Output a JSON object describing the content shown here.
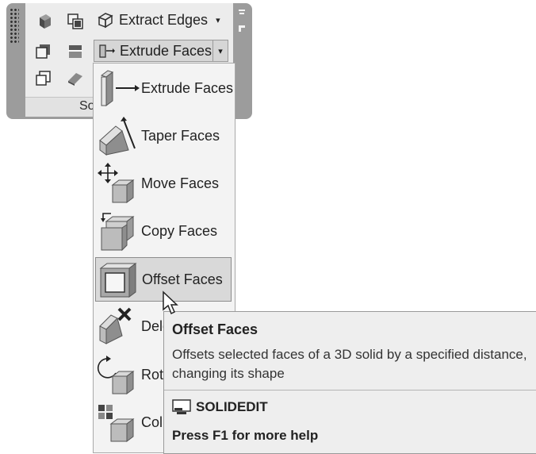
{
  "panel": {
    "title": "So",
    "extract_edges_label": "Extract Edges",
    "extract_edges_arrow": "▾",
    "extrude_faces_label": "Extrude Faces",
    "extrude_faces_arrow": "▾"
  },
  "menu": {
    "items": [
      {
        "label": "Extrude Faces",
        "icon": "extrude-faces-icon"
      },
      {
        "label": "Taper Faces",
        "icon": "taper-faces-icon"
      },
      {
        "label": "Move Faces",
        "icon": "move-faces-icon"
      },
      {
        "label": "Copy Faces",
        "icon": "copy-faces-icon"
      },
      {
        "label": "Offset Faces",
        "icon": "offset-faces-icon",
        "highlighted": true
      },
      {
        "label": "Dele",
        "icon": "delete-faces-icon"
      },
      {
        "label": "Rot",
        "icon": "rotate-faces-icon"
      },
      {
        "label": "Col",
        "icon": "color-faces-icon"
      }
    ]
  },
  "tooltip": {
    "title": "Offset Faces",
    "description": "Offsets selected faces of a 3D solid by a specified distance, changing its shape",
    "command": "SOLIDEDIT",
    "help": "Press F1 for more help"
  }
}
